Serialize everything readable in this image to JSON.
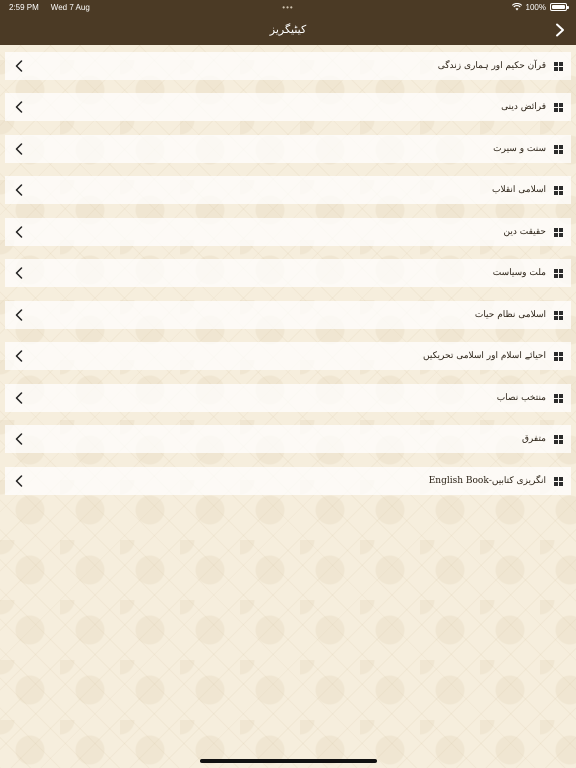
{
  "status_bar": {
    "time": "2:59 PM",
    "date": "Wed 7 Aug",
    "dots": "•••",
    "battery": "100%",
    "wifi_icon": "wifi-icon",
    "battery_icon": "battery-icon"
  },
  "nav": {
    "title": "کیٹیگریز",
    "back_icon": "chevron-right-icon"
  },
  "colors": {
    "nav_background": "#4b3a25",
    "page_background": "#f6eedd",
    "row_background": "#ffffff",
    "text": "#2b2216"
  },
  "categories": [
    {
      "label": "قرآن حکیم اور ہماری زندگی"
    },
    {
      "label": "فرائض دینی"
    },
    {
      "label": "سنت و سیرت"
    },
    {
      "label": "اسلامی انقلاب"
    },
    {
      "label": "حقیقت دین"
    },
    {
      "label": "ملت وسیاست"
    },
    {
      "label": "اسلامی نظام حیات"
    },
    {
      "label": "احیائے اسلام اور اسلامی تحریکیں"
    },
    {
      "label": "منتخب نصاب"
    },
    {
      "label": "متفرق"
    },
    {
      "label": "انگریزی کتابیں-English Book"
    }
  ]
}
